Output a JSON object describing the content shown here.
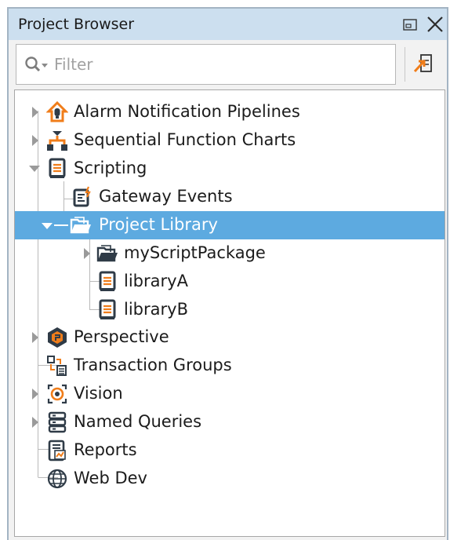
{
  "panel": {
    "title": "Project Browser",
    "restore_icon": "window-restore-icon",
    "close_icon": "close-icon"
  },
  "filter": {
    "placeholder": "Filter",
    "value": "",
    "search_icon": "search-icon",
    "link_button_icon": "link-with-editor-icon"
  },
  "tree": {
    "items": [
      {
        "label": "Alarm Notification Pipelines",
        "icon": "alarm-pipeline-icon",
        "expandable": true,
        "expanded": false
      },
      {
        "label": "Sequential Function Charts",
        "icon": "sfc-icon",
        "expandable": true,
        "expanded": false
      },
      {
        "label": "Scripting",
        "icon": "scripting-icon",
        "expandable": true,
        "expanded": true
      },
      {
        "label": "Gateway Events",
        "icon": "gateway-events-icon",
        "expandable": false
      },
      {
        "label": "Project Library",
        "icon": "folder-open-icon",
        "expandable": true,
        "expanded": true,
        "selected": true
      },
      {
        "label": "myScriptPackage",
        "icon": "folder-open-icon",
        "expandable": true,
        "expanded": false
      },
      {
        "label": "libraryA",
        "icon": "script-document-icon",
        "expandable": false
      },
      {
        "label": "libraryB",
        "icon": "script-document-icon",
        "expandable": false
      },
      {
        "label": "Perspective",
        "icon": "perspective-icon",
        "expandable": true,
        "expanded": false
      },
      {
        "label": "Transaction Groups",
        "icon": "transaction-groups-icon",
        "expandable": false
      },
      {
        "label": "Vision",
        "icon": "vision-icon",
        "expandable": true,
        "expanded": false
      },
      {
        "label": "Named Queries",
        "icon": "named-queries-icon",
        "expandable": true,
        "expanded": false
      },
      {
        "label": "Reports",
        "icon": "reports-icon",
        "expandable": false
      },
      {
        "label": "Web Dev",
        "icon": "web-dev-icon",
        "expandable": false
      }
    ]
  },
  "colors": {
    "title_bar": "#ccdfef",
    "selection": "#5daae0",
    "accent_orange": "#f07d1a",
    "icon_dark": "#2f3b47"
  }
}
